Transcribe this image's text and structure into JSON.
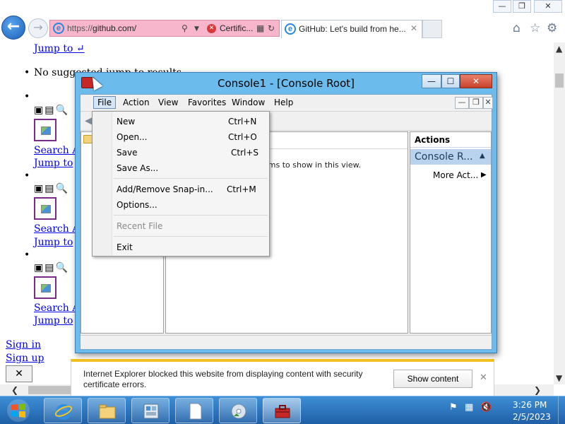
{
  "browser": {
    "address": {
      "protocol": "https://",
      "host": "github.com/",
      "cert_label": "Certific..."
    },
    "tab": {
      "title": "GitHub: Let's build from he..."
    },
    "window_buttons": [
      "—",
      "❐",
      "✕"
    ]
  },
  "page": {
    "jump_to_top": "Jump to ↵",
    "no_results": "No suggested jump to results",
    "items": [
      {
        "icons": "▣▤🔍",
        "search_label": "Search A",
        "jump_label": "Jump to"
      },
      {
        "icons": "▣▤🔍",
        "search_label": "Search A",
        "jump_label": "Jump to"
      },
      {
        "icons": "▣▤🔍",
        "search_label": "Search A",
        "jump_label": "Jump to"
      }
    ],
    "sign_in": "Sign in",
    "sign_up": "Sign up",
    "close_glyph": "✕"
  },
  "console": {
    "title": "Console1 - [Console Root]",
    "menu": [
      "File",
      "Action",
      "View",
      "Favorites",
      "Window",
      "Help"
    ],
    "result_empty": "ems to show in this view.",
    "actions": {
      "title": "Actions",
      "section": "Console R...",
      "more": "More Act..."
    }
  },
  "file_menu": {
    "items": [
      {
        "label": "New",
        "shortcut": "Ctrl+N"
      },
      {
        "label": "Open...",
        "shortcut": "Ctrl+O"
      },
      {
        "label": "Save",
        "shortcut": "Ctrl+S"
      },
      {
        "label": "Save As...",
        "shortcut": ""
      },
      {
        "label": "Add/Remove Snap-in...",
        "shortcut": "Ctrl+M"
      },
      {
        "label": "Options...",
        "shortcut": ""
      },
      {
        "label": "Recent File",
        "shortcut": ""
      },
      {
        "label": "Exit",
        "shortcut": ""
      }
    ]
  },
  "notification": {
    "text": "Internet Explorer blocked this website from displaying content with security certificate errors.",
    "button": "Show content",
    "close": "✕"
  },
  "taskbar": {
    "time": "3:26 PM",
    "date": "2/5/2023",
    "apps": [
      "internet-explorer",
      "file-explorer",
      "control-panel",
      "document",
      "media-disc",
      "toolbox"
    ]
  },
  "colors": {
    "address_bar_error": "#f7b6cc",
    "console_frame": "#6bbcec",
    "taskbar": "#2a6fbd",
    "notification_accent": "#f0c020",
    "link": "#0000ee"
  }
}
